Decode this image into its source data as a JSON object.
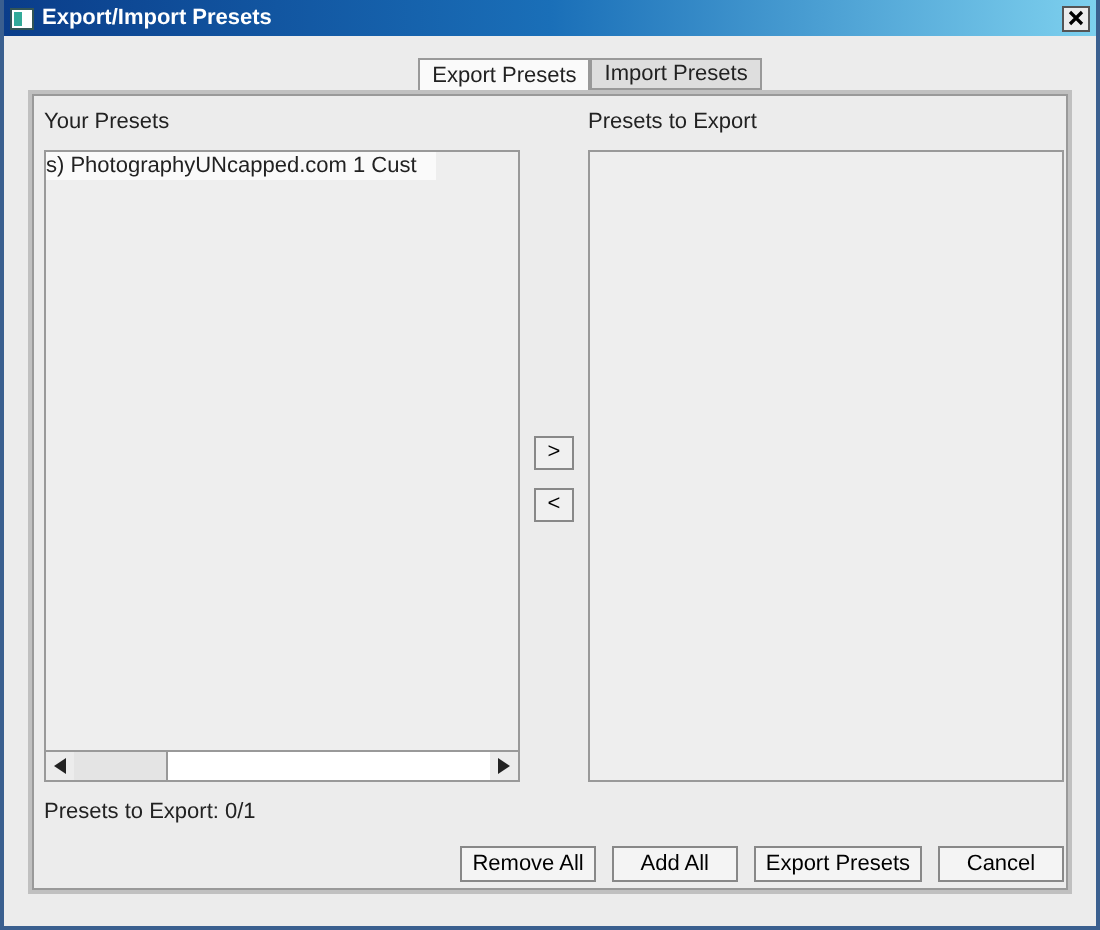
{
  "window": {
    "title": "Export/Import Presets"
  },
  "tabs": [
    {
      "label": "Export Presets",
      "selected": true
    },
    {
      "label": "Import Presets",
      "selected": false
    }
  ],
  "your_presets": {
    "label": "Your Presets",
    "items": [
      {
        "text": "s)  PhotographyUNcapped.com 1 Cust",
        "selected": true
      }
    ]
  },
  "transfer_buttons": [
    ">",
    "<"
  ],
  "presets_to_export": {
    "label": "Presets to Export"
  },
  "status": "Presets to Export: 0/1",
  "buttons": [
    "Remove All",
    "Add All",
    "Export Presets",
    "Cancel"
  ]
}
